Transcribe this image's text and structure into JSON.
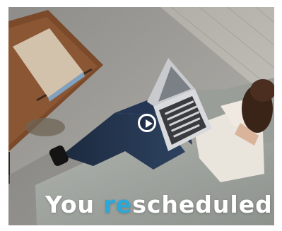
{
  "video": {
    "play_icon": "play-icon",
    "caption": {
      "prefix": "You ",
      "accent": "re",
      "suffix": "scheduled"
    }
  },
  "colors": {
    "accent": "#2aa9d8",
    "caption_text": "#ffffff"
  }
}
